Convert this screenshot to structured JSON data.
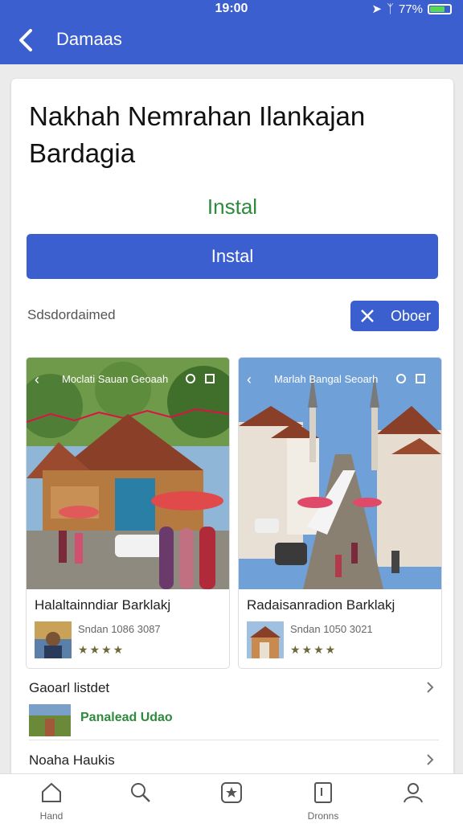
{
  "status": {
    "time": "19:00",
    "battery": "77%",
    "battery_level": 0.77
  },
  "appbar": {
    "title": "Damaas"
  },
  "card": {
    "heading": "Nakhah Nemrahan Ilankajan Bardagia",
    "install_link": "Instal",
    "install_button": "Instal",
    "meta_label": "Sdsdordaimed",
    "close_button": "Oboer"
  },
  "tiles": [
    {
      "shot_title": "Moclati Sauan Geoaah",
      "name": "Halaltainndiar Barklakj",
      "date": "Sndan 1086 3087",
      "rating": "★★★★"
    },
    {
      "shot_title": "Marlah Bangal Seoarh",
      "name": "Radaisanradion Barklakj",
      "date": "Sndan 1050 3021",
      "rating": "★★★★"
    }
  ],
  "section": {
    "label": "Gaoarl listdet",
    "sub_label": "Panalead Udao"
  },
  "row2": {
    "label": "Noaha Haukis"
  },
  "bottom_nav": [
    {
      "icon": "home-icon",
      "label": "Hand"
    },
    {
      "icon": "search-icon",
      "label": ""
    },
    {
      "icon": "star-icon",
      "label": ""
    },
    {
      "icon": "book-icon",
      "label": "Dronns"
    },
    {
      "icon": "profile-icon",
      "label": ""
    }
  ],
  "colors": {
    "primary": "#3c5fd0",
    "accent_green": "#2e8a3c"
  }
}
